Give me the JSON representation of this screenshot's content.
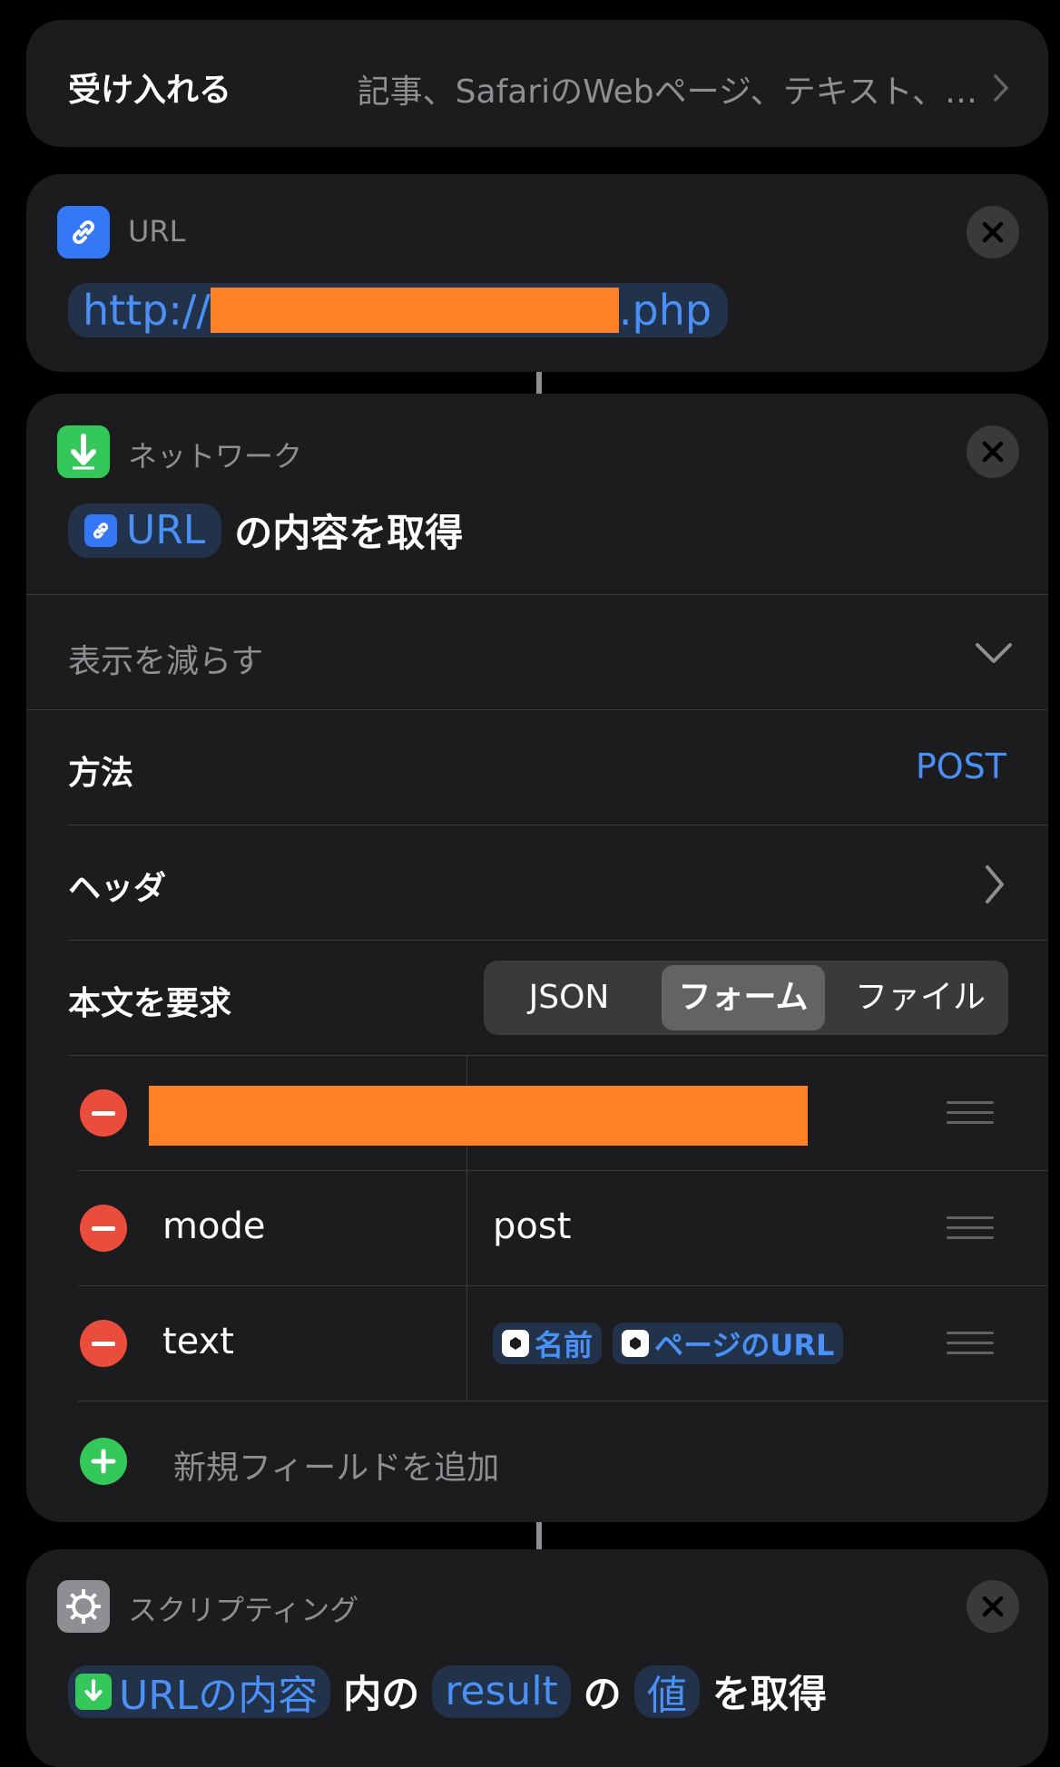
{
  "accepts": {
    "label": "受け入れる",
    "value": "記事、SafariのWebページ、テキスト、…"
  },
  "url_action": {
    "category": "URL",
    "url_prefix": "http://",
    "url_suffix": ".php"
  },
  "network_action": {
    "category": "ネットワーク",
    "token_url": "URL",
    "title_suffix": "の内容を取得",
    "show_less": "表示を減らす",
    "method_label": "方法",
    "method_value": "POST",
    "headers_label": "ヘッダ",
    "body_label": "本文を要求",
    "body_segments": [
      "JSON",
      "フォーム",
      "ファイル"
    ],
    "body_selected": "フォーム",
    "fields": [
      {
        "key": "mode",
        "value": "post"
      },
      {
        "key": "text",
        "value_tokens": [
          "名前",
          "ページのURL"
        ]
      }
    ],
    "add_field": "新規フィールドを追加"
  },
  "scripting_action": {
    "category": "スクリプティング",
    "token1": "URLの内容",
    "text1": "内の",
    "token2": "result",
    "text2": "の",
    "token3": "値",
    "text3": "を取得"
  },
  "colors": {
    "accent": "#4a90f5",
    "redaction": "#fe8125",
    "card": "#1c1c1e",
    "remove": "#eb4d3d",
    "add": "#34c759"
  }
}
